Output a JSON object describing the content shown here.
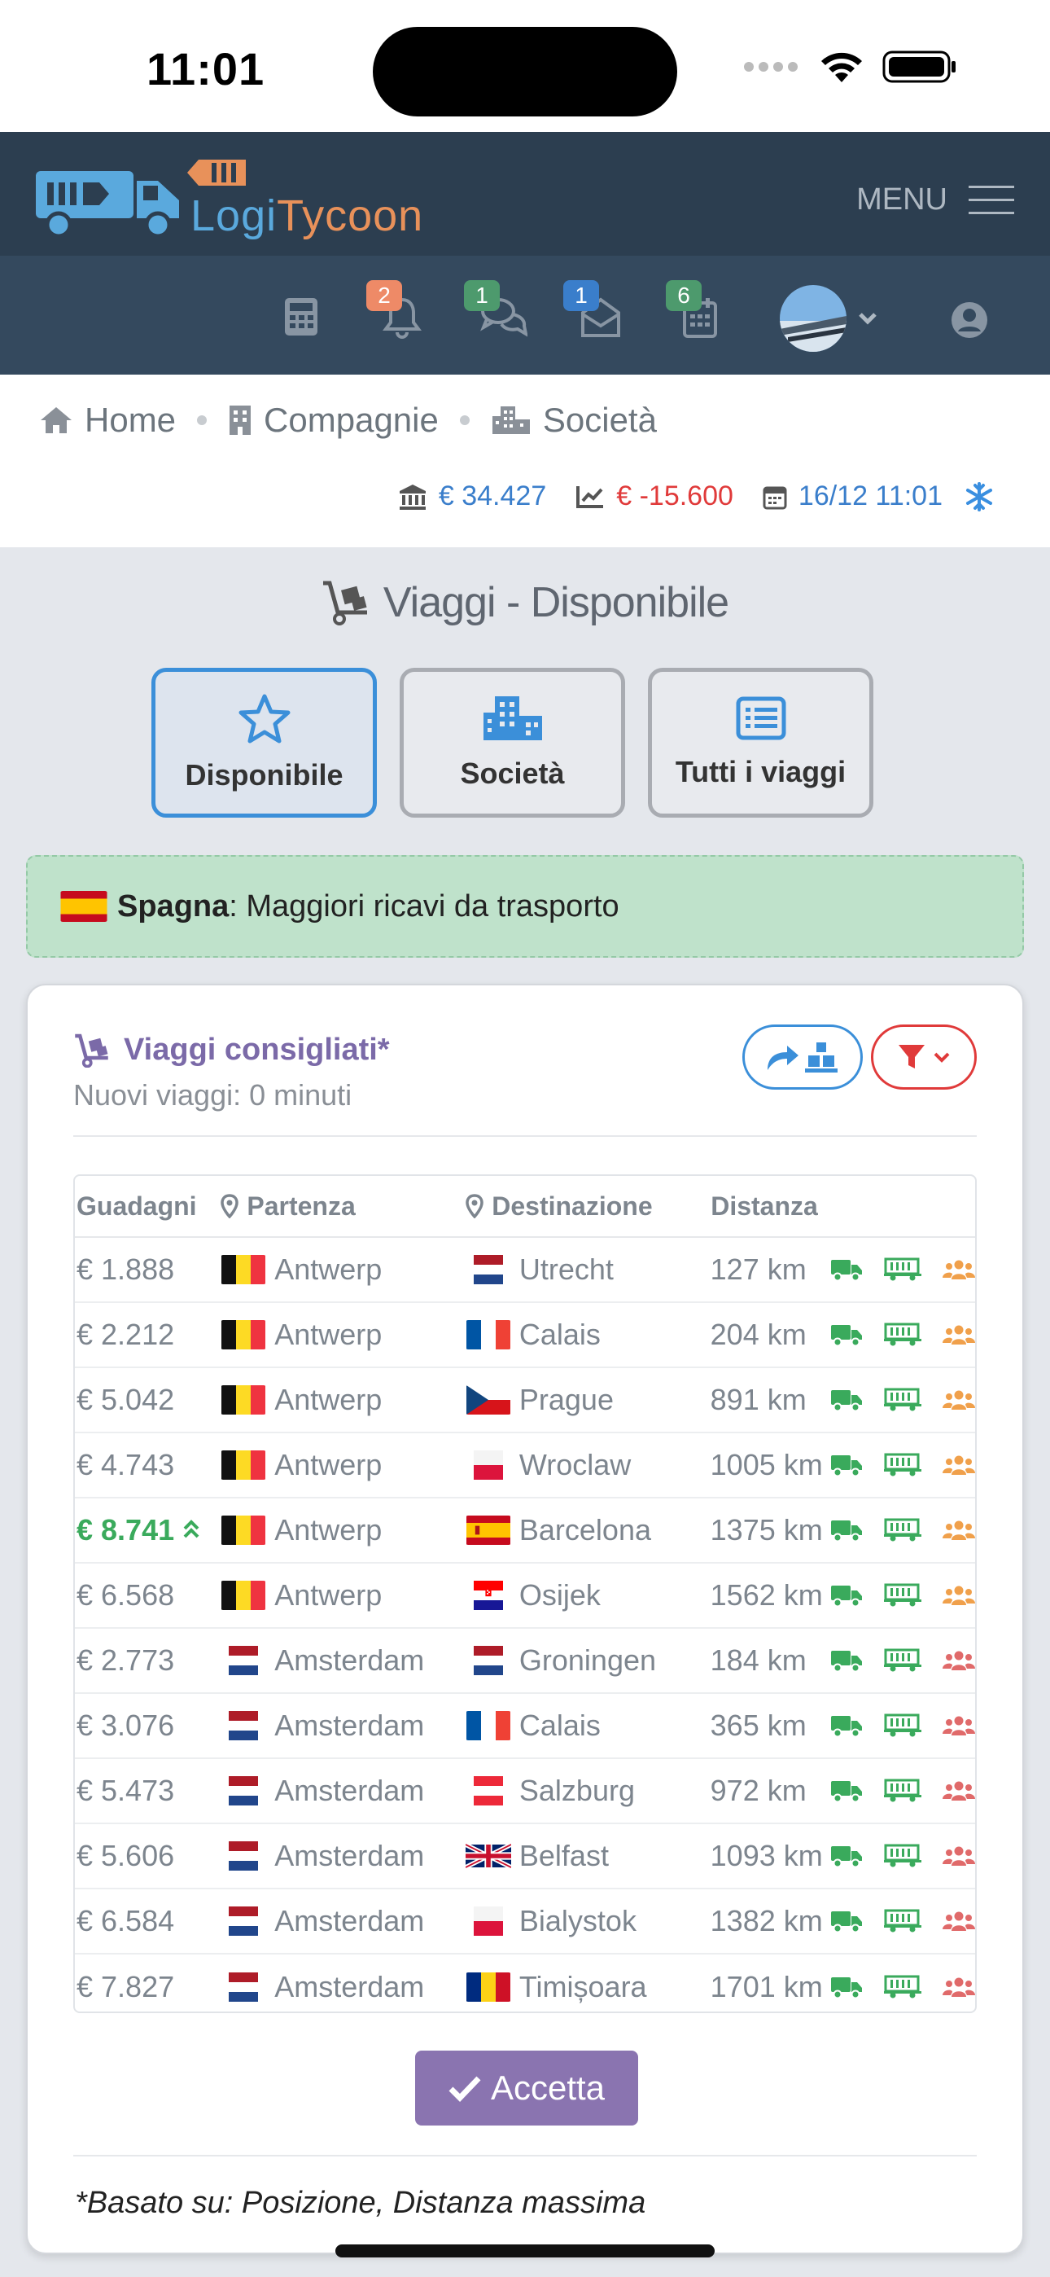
{
  "status": {
    "time": "11:01"
  },
  "brand": {
    "logi": "Logi",
    "tycoon": "Tycoon"
  },
  "menu": {
    "label": "MENU"
  },
  "badges": {
    "notifications": "2",
    "messages": "1",
    "mail": "1",
    "calendar": "6"
  },
  "breadcrumb": {
    "home": "Home",
    "companies": "Compagnie",
    "company": "Società"
  },
  "stats": {
    "cash": "€ 34.427",
    "profit": "€ -15.600",
    "date": "16/12 11:01"
  },
  "colors": {
    "navbar": "#2c3e50",
    "iconbar": "#34495e",
    "positive": "#3aaa5c",
    "negative": "#e03a3a",
    "accent": "#3b8fd9",
    "purple": "#8a74b0"
  },
  "page": {
    "title": "Viaggi - Disponibile"
  },
  "tabs": [
    {
      "label": "Disponibile",
      "icon": "star-icon"
    },
    {
      "label": "Società",
      "icon": "building-icon"
    },
    {
      "label": "Tutti i viaggi",
      "icon": "list-icon"
    }
  ],
  "alert": {
    "country": "Spagna",
    "text": ": Maggiori ricavi da trasporto"
  },
  "card": {
    "title": "Viaggi consigliati*",
    "subtitle": "Nuovi viaggi: 0 minuti",
    "accept": "Accetta",
    "footnote": "*Basato su: Posizione, Distanza massima"
  },
  "table": {
    "headers": {
      "earnings": "Guadagni",
      "from": "Partenza",
      "to": "Destinazione",
      "distance": "Distanza"
    },
    "rows": [
      {
        "earnings": "€ 1.888",
        "from": "Antwerp",
        "from_flag": "be",
        "to": "Utrecht",
        "to_flag": "nl",
        "distance": "127 km",
        "best": false,
        "people": "orange"
      },
      {
        "earnings": "€ 2.212",
        "from": "Antwerp",
        "from_flag": "be",
        "to": "Calais",
        "to_flag": "fr",
        "distance": "204 km",
        "best": false,
        "people": "orange"
      },
      {
        "earnings": "€ 5.042",
        "from": "Antwerp",
        "from_flag": "be",
        "to": "Prague",
        "to_flag": "cz",
        "distance": "891 km",
        "best": false,
        "people": "orange"
      },
      {
        "earnings": "€ 4.743",
        "from": "Antwerp",
        "from_flag": "be",
        "to": "Wroclaw",
        "to_flag": "pl",
        "distance": "1005 km",
        "best": false,
        "people": "orange"
      },
      {
        "earnings": "€ 8.741",
        "from": "Antwerp",
        "from_flag": "be",
        "to": "Barcelona",
        "to_flag": "es",
        "distance": "1375 km",
        "best": true,
        "people": "orange"
      },
      {
        "earnings": "€ 6.568",
        "from": "Antwerp",
        "from_flag": "be",
        "to": "Osijek",
        "to_flag": "hr",
        "distance": "1562 km",
        "best": false,
        "people": "orange"
      },
      {
        "earnings": "€ 2.773",
        "from": "Amsterdam",
        "from_flag": "nl",
        "to": "Groningen",
        "to_flag": "nl",
        "distance": "184 km",
        "best": false,
        "people": "red"
      },
      {
        "earnings": "€ 3.076",
        "from": "Amsterdam",
        "from_flag": "nl",
        "to": "Calais",
        "to_flag": "fr",
        "distance": "365 km",
        "best": false,
        "people": "red"
      },
      {
        "earnings": "€ 5.473",
        "from": "Amsterdam",
        "from_flag": "nl",
        "to": "Salzburg",
        "to_flag": "at",
        "distance": "972 km",
        "best": false,
        "people": "red"
      },
      {
        "earnings": "€ 5.606",
        "from": "Amsterdam",
        "from_flag": "nl",
        "to": "Belfast",
        "to_flag": "gb",
        "distance": "1093 km",
        "best": false,
        "people": "red"
      },
      {
        "earnings": "€ 6.584",
        "from": "Amsterdam",
        "from_flag": "nl",
        "to": "Bialystok",
        "to_flag": "pl",
        "distance": "1382 km",
        "best": false,
        "people": "red"
      },
      {
        "earnings": "€ 7.827",
        "from": "Amsterdam",
        "from_flag": "nl",
        "to": "Timișoara",
        "to_flag": "ro",
        "distance": "1701 km",
        "best": false,
        "people": "red"
      }
    ]
  }
}
